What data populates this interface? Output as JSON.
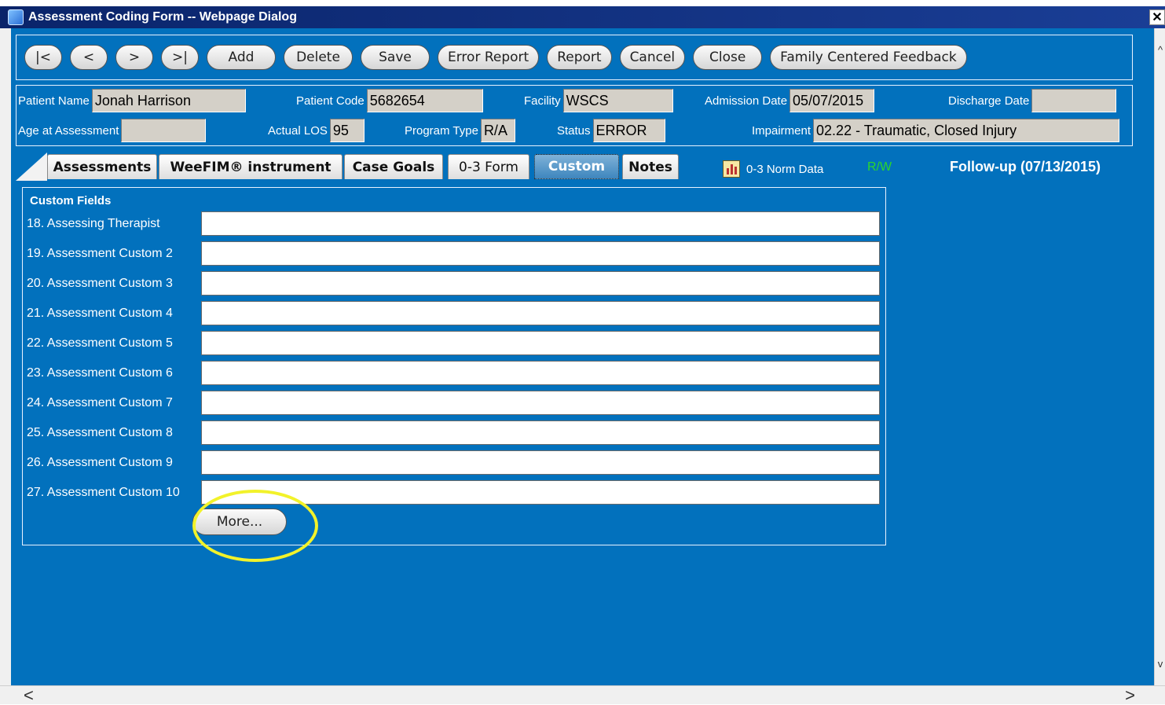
{
  "window": {
    "title": "Assessment Coding Form -- Webpage Dialog",
    "close_glyph": "✕"
  },
  "toolbar": {
    "first": "|<",
    "prev": "<",
    "next": ">",
    "last": ">|",
    "add": "Add",
    "delete": "Delete",
    "save": "Save",
    "error_report": "Error Report",
    "report": "Report",
    "cancel": "Cancel",
    "close": "Close",
    "family_feedback": "Family Centered Feedback"
  },
  "patient": {
    "name_label": "Patient Name",
    "name": "Jonah Harrison",
    "code_label": "Patient Code",
    "code": "5682654",
    "facility_label": "Facility",
    "facility": "WSCS",
    "admission_label": "Admission Date",
    "admission": "05/07/2015",
    "discharge_label": "Discharge Date",
    "discharge": "",
    "age_label": "Age at Assessment",
    "age": "",
    "los_label": "Actual LOS",
    "los": "95",
    "program_label": "Program Type",
    "program": "R/A",
    "status_label": "Status",
    "status": "ERROR",
    "impairment_label": "Impairment",
    "impairment": "02.22 - Traumatic, Closed Injury"
  },
  "tabs": {
    "assessments": "Assessments",
    "weefim": "WeeFIM® instrument",
    "case_goals": "Case Goals",
    "form03": "0-3 Form",
    "custom": "Custom",
    "notes": "Notes",
    "active": "Custom"
  },
  "header_right": {
    "norm_data": "0-3 Norm Data",
    "norm_icon": "bar-chart-icon",
    "rw": "R/W",
    "rw_color": "#2bd62b",
    "followup": "Follow-up (07/13/2015)"
  },
  "custom_fields": {
    "title": "Custom Fields",
    "fields": [
      {
        "label": "18. Assessing Therapist",
        "value": ""
      },
      {
        "label": "19. Assessment Custom 2",
        "value": ""
      },
      {
        "label": "20. Assessment Custom 3",
        "value": ""
      },
      {
        "label": "21. Assessment Custom 4",
        "value": ""
      },
      {
        "label": "22. Assessment Custom 5",
        "value": ""
      },
      {
        "label": "23. Assessment Custom 6",
        "value": ""
      },
      {
        "label": "24. Assessment Custom 7",
        "value": ""
      },
      {
        "label": "25. Assessment Custom 8",
        "value": ""
      },
      {
        "label": "26. Assessment Custom 9",
        "value": ""
      },
      {
        "label": "27. Assessment Custom 10",
        "value": ""
      }
    ],
    "more_button": "More..."
  },
  "scroll": {
    "up": "^",
    "down": "v",
    "left": "<",
    "right": ">"
  },
  "colors": {
    "background": "#0271bd",
    "highlight": "#f2f22a",
    "titlebar": "#0a246a"
  }
}
